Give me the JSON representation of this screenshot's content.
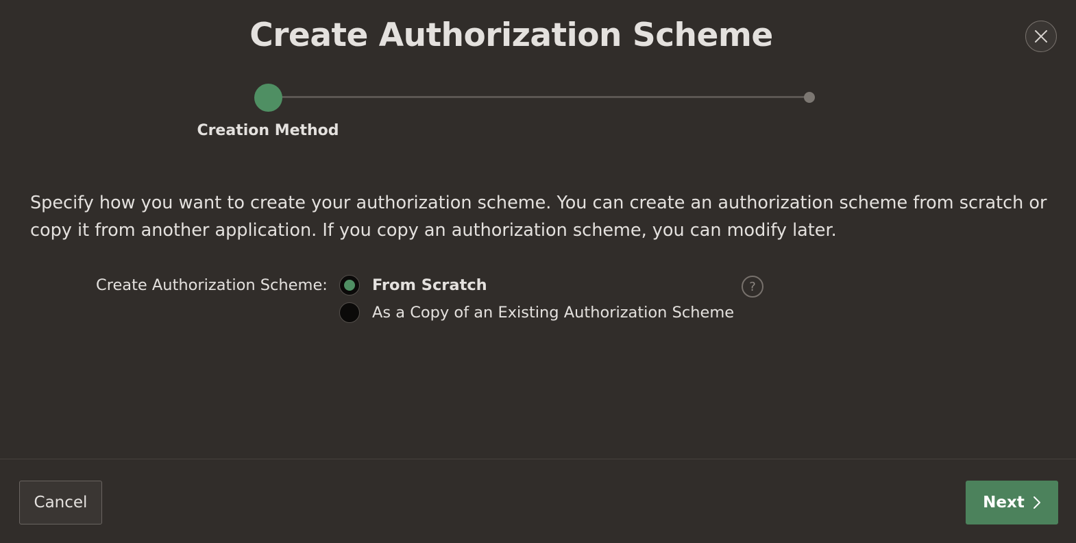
{
  "dialog": {
    "title": "Create Authorization Scheme",
    "close_icon": "close-icon"
  },
  "wizard": {
    "steps": [
      {
        "label": "Creation Method",
        "state": "active"
      },
      {
        "label": "",
        "state": "pending"
      }
    ],
    "active_color": "#4f8f63"
  },
  "main": {
    "description": "Specify how you want to create your authorization scheme. You can create an authorization scheme from scratch or copy it from another application. If you copy an authorization scheme, you can modify later.",
    "field": {
      "label": "Create Authorization Scheme:",
      "options": [
        {
          "label": "From Scratch",
          "selected": true
        },
        {
          "label": "As a Copy of an Existing Authorization Scheme",
          "selected": false
        }
      ],
      "help_icon": "?"
    }
  },
  "footer": {
    "cancel_label": "Cancel",
    "next_label": "Next",
    "next_icon": "chevron-right-icon",
    "next_color": "#4c825c"
  }
}
